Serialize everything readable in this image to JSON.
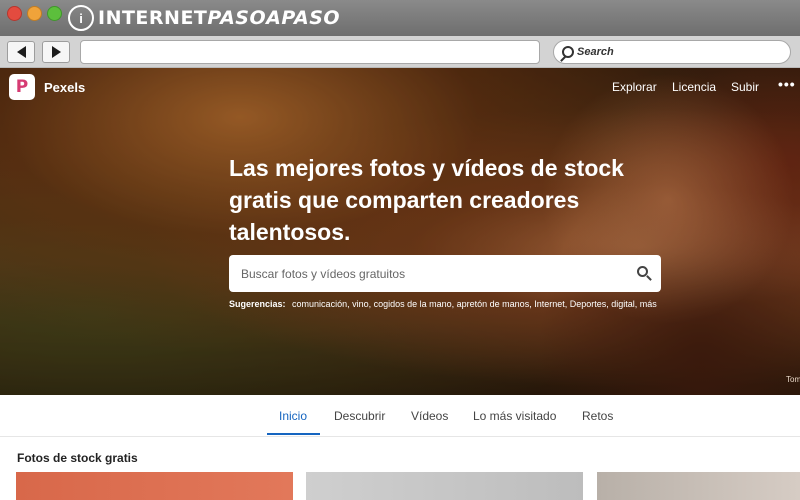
{
  "window": {
    "brand_logo_letter": "i",
    "brand_name_part1": "INTERNET",
    "brand_name_part2": "PASOAPASO",
    "search_label": "Search"
  },
  "site": {
    "logo_letter": "P",
    "name": "Pexels",
    "nav": [
      "Explorar",
      "Licencia",
      "Subir",
      "•••"
    ]
  },
  "hero": {
    "headline": "Las mejores fotos y vídeos de stock gratis que comparten creadores talentosos.",
    "search_placeholder": "Buscar fotos y vídeos gratuitos",
    "suggestions_label": "Sugerencias:",
    "suggestions_text": "comunicación, vino, cogidos de la mano, apretón de manos, Internet, Deportes, digital, más",
    "credit": "Tom"
  },
  "tabs": [
    "Inicio",
    "Descubrir",
    "Vídeos",
    "Lo más visitado",
    "Retos"
  ],
  "active_tab": "Inicio",
  "section_title": "Fotos de stock gratis",
  "colors": {
    "accent": "#1565c0",
    "pexels_brand": "#d63b73"
  }
}
